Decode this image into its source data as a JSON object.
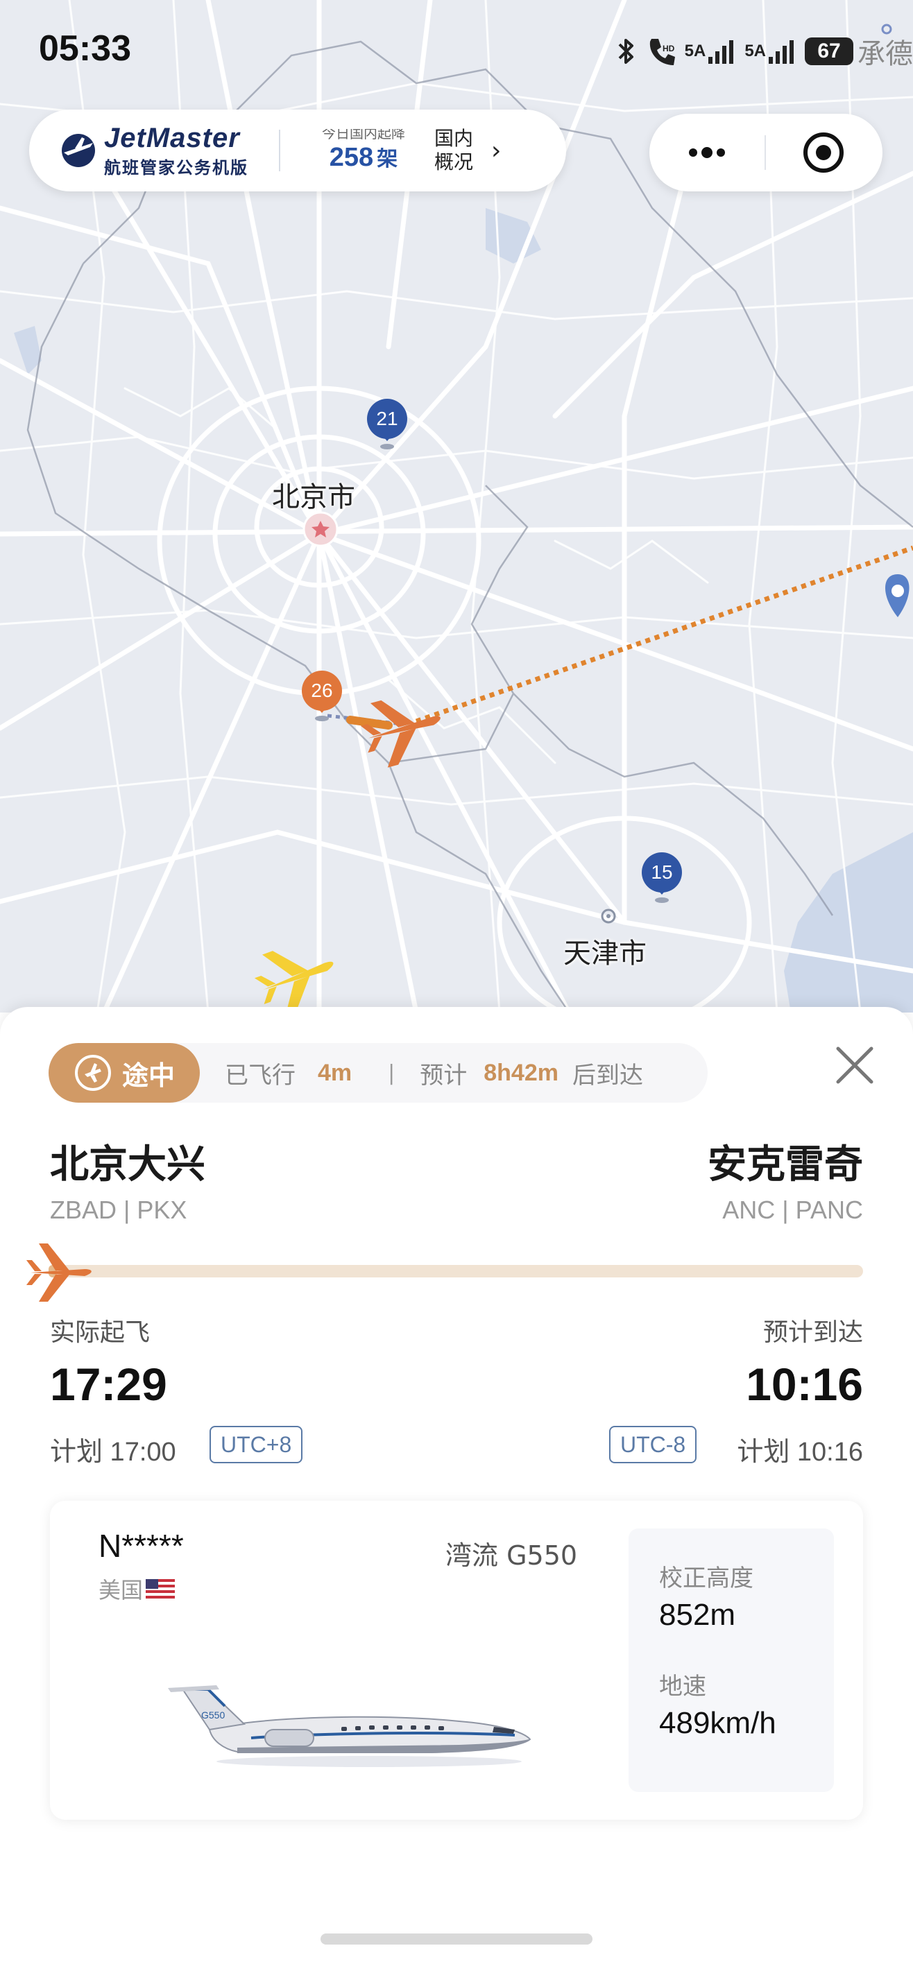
{
  "status_bar": {
    "time": "05:33",
    "network_1": "5A",
    "network_2": "5A",
    "battery": "67",
    "city_fragment": "承德"
  },
  "brand": {
    "name": "JetMaster",
    "subtitle": "航班管家公务机版",
    "count_caption": "今日国内起降",
    "count_value": "258",
    "count_unit": "架",
    "domestic_label": "国内概况",
    "chevron": "›"
  },
  "map": {
    "labels": {
      "beijing": "北京市",
      "tianjin": "天津市"
    },
    "pins": [
      {
        "label": "21",
        "color": "#2f55a4"
      },
      {
        "label": "26",
        "color": "#e0763a"
      },
      {
        "label": "15",
        "color": "#2f55a4"
      }
    ],
    "route_color": "#e0842e"
  },
  "flight": {
    "status_chip": "途中",
    "flown_label": "已飞行",
    "flown_value": "4m",
    "separator": "|",
    "eta_prefix": "预计",
    "eta_value": "8h42m",
    "eta_suffix": "后到达",
    "progress": 0.01,
    "origin": {
      "city": "北京大兴",
      "codes": "ZBAD | PKX",
      "time_label": "实际起飞",
      "time": "17:29",
      "scheduled": "计划 17:00",
      "utc": "UTC+8"
    },
    "destination": {
      "city": "安克雷奇",
      "codes": "ANC | PANC",
      "time_label": "预计到达",
      "time": "10:16",
      "scheduled": "计划 10:16",
      "utc": "UTC-8"
    }
  },
  "aircraft": {
    "registration": "N*****",
    "country": "美国",
    "model": "湾流 G550",
    "altitude_label": "校正高度",
    "altitude_value": "852m",
    "speed_label": "地速",
    "speed_value": "489km/h",
    "tail_text": "G550"
  },
  "colors": {
    "accent": "#d19a66",
    "brand_blue": "#2752a4",
    "route_orange": "#e0842e"
  }
}
